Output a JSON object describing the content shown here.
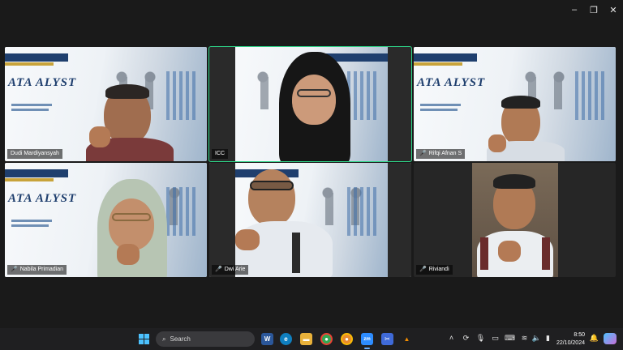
{
  "window": {
    "controls": {
      "minimize": "–",
      "maximize": "❐",
      "close": "✕"
    }
  },
  "participants": [
    {
      "name": "Dudi Mardiyansyah",
      "muted": false,
      "active": false
    },
    {
      "name": "ICC",
      "muted": false,
      "active": true
    },
    {
      "name": "Rifqi Afnan S",
      "muted": true,
      "active": false
    },
    {
      "name": "Nabila Primadian",
      "muted": true,
      "active": false
    },
    {
      "name": "Dwi Arie",
      "muted": true,
      "active": false
    },
    {
      "name": "Riviandi",
      "muted": true,
      "active": false
    }
  ],
  "slide": {
    "big_text": "ATA ALYST"
  },
  "taskbar": {
    "search_label": "Search",
    "apps": [
      {
        "icon": "word-icon",
        "label": "W",
        "color": "#2b579a"
      },
      {
        "icon": "edge-icon",
        "label": "e",
        "color": "#0f7fbf"
      },
      {
        "icon": "file-explorer-icon",
        "label": "▬",
        "color": "#e8b13a"
      },
      {
        "icon": "chrome-icon",
        "label": "●",
        "color": "#34a853"
      },
      {
        "icon": "chrome-profile-icon",
        "label": "●",
        "color": "#ea8c2e"
      },
      {
        "icon": "zoom-icon",
        "label": "zm",
        "color": "#2d8cff"
      },
      {
        "icon": "snipping-tool-icon",
        "label": "✂",
        "color": "#3f6ad8"
      },
      {
        "icon": "vlc-icon",
        "label": "▲",
        "color": "#f28c00"
      }
    ],
    "time": "8:50",
    "date": "22/10/2024"
  },
  "colors": {
    "active_border": "#2ed88a",
    "accent": "#4cc2ff"
  }
}
